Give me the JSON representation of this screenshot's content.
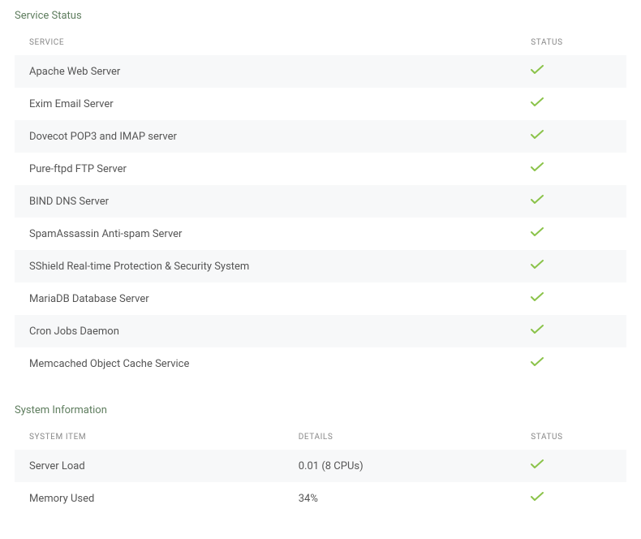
{
  "serviceStatus": {
    "title": "Service Status",
    "columns": {
      "service": "SERVICE",
      "status": "STATUS"
    },
    "rows": [
      {
        "name": "Apache Web Server",
        "status": "ok"
      },
      {
        "name": "Exim Email Server",
        "status": "ok"
      },
      {
        "name": "Dovecot POP3 and IMAP server",
        "status": "ok"
      },
      {
        "name": "Pure-ftpd FTP Server",
        "status": "ok"
      },
      {
        "name": "BIND DNS Server",
        "status": "ok"
      },
      {
        "name": "SpamAssassin Anti-spam Server",
        "status": "ok"
      },
      {
        "name": "SShield Real-time Protection & Security System",
        "status": "ok"
      },
      {
        "name": "MariaDB Database Server",
        "status": "ok"
      },
      {
        "name": "Cron Jobs Daemon",
        "status": "ok"
      },
      {
        "name": "Memcached Object Cache Service",
        "status": "ok"
      }
    ]
  },
  "systemInfo": {
    "title": "System Information",
    "columns": {
      "item": "SYSTEM ITEM",
      "details": "DETAILS",
      "status": "STATUS"
    },
    "rows": [
      {
        "item": "Server Load",
        "details": "0.01 (8 CPUs)",
        "status": "ok"
      },
      {
        "item": "Memory Used",
        "details": "34%",
        "status": "ok"
      }
    ]
  },
  "colors": {
    "check": "#8bc34a"
  }
}
